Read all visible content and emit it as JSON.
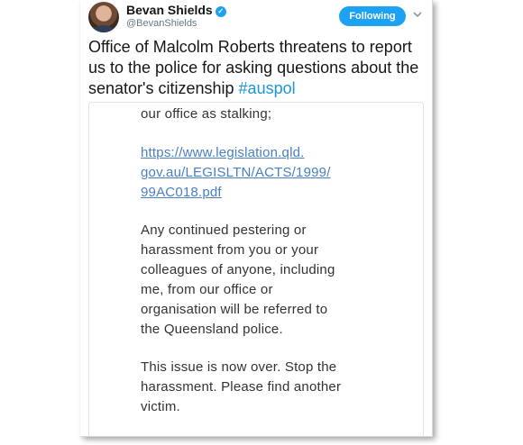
{
  "tweet": {
    "author_name": "Bevan Shields",
    "author_handle": "@BevanShields",
    "follow_label": "Following",
    "text": "Office of Malcolm Roberts threatens to report us to the police for asking questions about the senator's citizenship",
    "hashtag": "#auspol"
  },
  "icons": {
    "verified": "verified-badge-icon",
    "menu": "chevron-down-icon",
    "avatar": "profile-photo"
  },
  "colors": {
    "accent": "#1da1f2",
    "hashtag": "#1b95e0",
    "link": "#4a7fc1"
  },
  "embedded_screenshot": {
    "lines": [
      "our office as stalking;",
      "https://www.legislation.qld.",
      "gov.au/LEGISLTN/ACTS/1999/",
      "99AC018.pdf",
      "Any continued pestering or",
      "harassment from you or your",
      "colleagues of anyone, including",
      "me, from our office or",
      "organisation will be referred to",
      "the Queensland police.",
      "This issue is now over. Stop the",
      "harassment. Please find another",
      "victim."
    ]
  }
}
